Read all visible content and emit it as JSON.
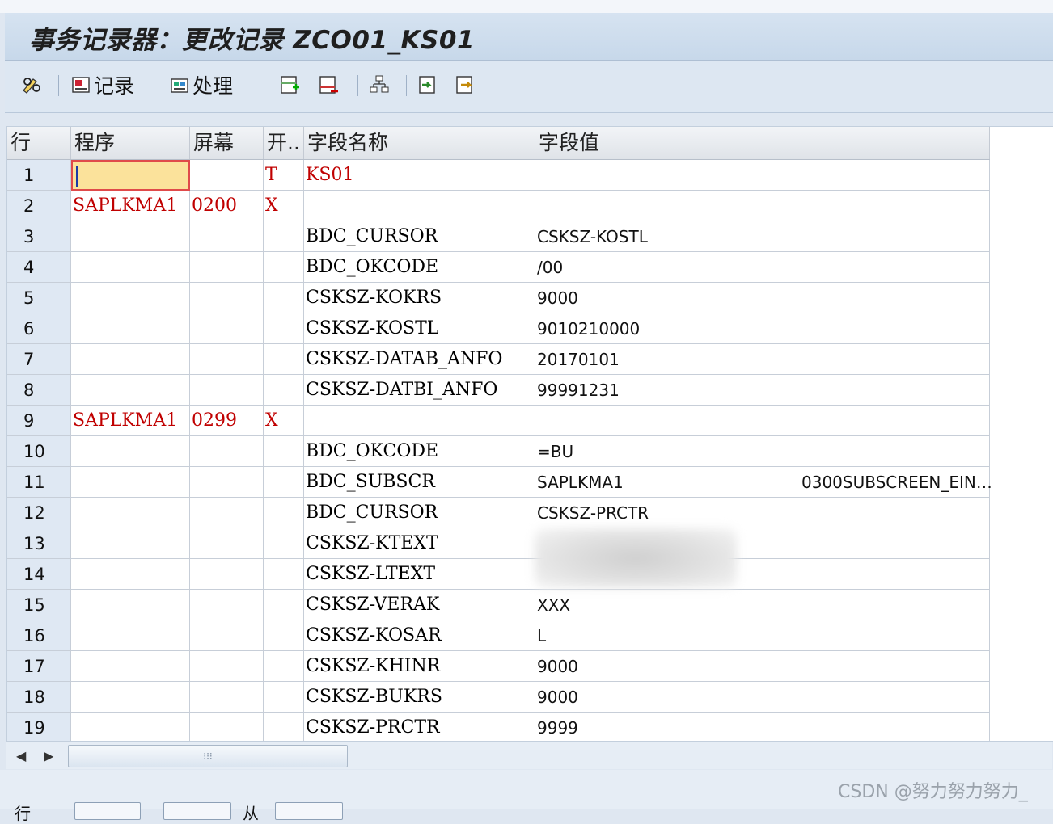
{
  "window": {
    "title": "事务记录器：更改记录 ZCO01_KS01"
  },
  "toolbar": {
    "record_label": "记录",
    "process_label": "处理"
  },
  "grid": {
    "headers": [
      "行",
      "程序",
      "屏幕",
      "开..",
      "字段名称",
      "字段值"
    ],
    "rows": [
      {
        "n": "1",
        "prog": "",
        "screen": "",
        "start": "T",
        "field": "KS01",
        "value": "",
        "value2": ""
      },
      {
        "n": "2",
        "prog": "SAPLKMA1",
        "screen": "0200",
        "start": "X",
        "field": "",
        "value": "",
        "value2": ""
      },
      {
        "n": "3",
        "prog": "",
        "screen": "",
        "start": "",
        "field": "BDC_CURSOR",
        "value": "CSKSZ-KOSTL",
        "value2": ""
      },
      {
        "n": "4",
        "prog": "",
        "screen": "",
        "start": "",
        "field": "BDC_OKCODE",
        "value": "/00",
        "value2": ""
      },
      {
        "n": "5",
        "prog": "",
        "screen": "",
        "start": "",
        "field": "CSKSZ-KOKRS",
        "value": "9000",
        "value2": ""
      },
      {
        "n": "6",
        "prog": "",
        "screen": "",
        "start": "",
        "field": "CSKSZ-KOSTL",
        "value": "9010210000",
        "value2": ""
      },
      {
        "n": "7",
        "prog": "",
        "screen": "",
        "start": "",
        "field": "CSKSZ-DATAB_ANFO",
        "value": "20170101",
        "value2": ""
      },
      {
        "n": "8",
        "prog": "",
        "screen": "",
        "start": "",
        "field": "CSKSZ-DATBI_ANFO",
        "value": "99991231",
        "value2": ""
      },
      {
        "n": "9",
        "prog": "SAPLKMA1",
        "screen": "0299",
        "start": "X",
        "field": "",
        "value": "",
        "value2": ""
      },
      {
        "n": "10",
        "prog": "",
        "screen": "",
        "start": "",
        "field": "BDC_OKCODE",
        "value": "=BU",
        "value2": ""
      },
      {
        "n": "11",
        "prog": "",
        "screen": "",
        "start": "",
        "field": "BDC_SUBSCR",
        "value": "SAPLKMA1",
        "value2": "0300SUBSCREEN_EIN…"
      },
      {
        "n": "12",
        "prog": "",
        "screen": "",
        "start": "",
        "field": "BDC_CURSOR",
        "value": "CSKSZ-PRCTR",
        "value2": ""
      },
      {
        "n": "13",
        "prog": "",
        "screen": "",
        "start": "",
        "field": "CSKSZ-KTEXT",
        "value": "",
        "value2": ""
      },
      {
        "n": "14",
        "prog": "",
        "screen": "",
        "start": "",
        "field": "CSKSZ-LTEXT",
        "value": "",
        "value2": ""
      },
      {
        "n": "15",
        "prog": "",
        "screen": "",
        "start": "",
        "field": "CSKSZ-VERAK",
        "value": "XXX",
        "value2": ""
      },
      {
        "n": "16",
        "prog": "",
        "screen": "",
        "start": "",
        "field": "CSKSZ-KOSAR",
        "value": "L",
        "value2": ""
      },
      {
        "n": "17",
        "prog": "",
        "screen": "",
        "start": "",
        "field": "CSKSZ-KHINR",
        "value": "9000",
        "value2": ""
      },
      {
        "n": "18",
        "prog": "",
        "screen": "",
        "start": "",
        "field": "CSKSZ-BUKRS",
        "value": "9000",
        "value2": ""
      },
      {
        "n": "19",
        "prog": "",
        "screen": "",
        "start": "",
        "field": "CSKSZ-PRCTR",
        "value": "9999",
        "value2": ""
      }
    ]
  },
  "footer": {
    "label": "行",
    "text": "从"
  },
  "watermark": "CSDN @努力努力努力_",
  "colors": {
    "accent_red": "#c00000",
    "title_bar": "#c7d8ea",
    "row_number_bg": "#dfe8f3",
    "selected_cell": "#fbe29b"
  }
}
